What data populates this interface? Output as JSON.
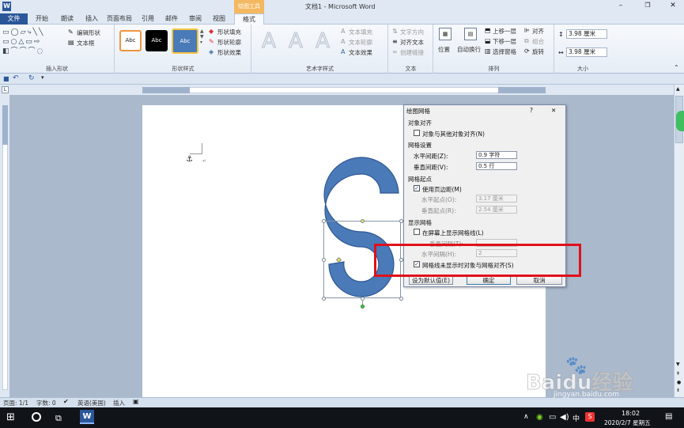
{
  "window": {
    "title": "文档1 - Microsoft Word",
    "context_tab_group": "绘图工具",
    "app_icon": "word-icon"
  },
  "tabs": [
    {
      "label": "文件"
    },
    {
      "label": "开始"
    },
    {
      "label": "朗读"
    },
    {
      "label": "插入"
    },
    {
      "label": "页面布局"
    },
    {
      "label": "引用"
    },
    {
      "label": "邮件"
    },
    {
      "label": "审阅"
    },
    {
      "label": "视图"
    },
    {
      "label": "格式"
    }
  ],
  "ribbon": {
    "insert_shapes": {
      "label": "插入形状",
      "edit_shape": "编辑形状",
      "text_box": "文本框"
    },
    "shape_styles": {
      "label": "形状样式",
      "sample": "Abc",
      "fill": "形状填充",
      "outline": "形状轮廓",
      "effects": "形状效果"
    },
    "wordart": {
      "label": "艺术字样式",
      "sample": "A",
      "text_fill": "文本填充",
      "text_outline": "文本轮廓",
      "text_effects": "文本效果"
    },
    "text": {
      "label": "文本",
      "direction": "文字方向",
      "align": "对齐文本",
      "link": "创建链接"
    },
    "arrange": {
      "label": "排列",
      "position": "位置",
      "wrap": "自动换行",
      "bring_forward": "上移一层",
      "send_backward": "下移一层",
      "selection_pane": "选择窗格",
      "align": "对齐",
      "group": "组合",
      "rotate": "旋转"
    },
    "size": {
      "label": "大小",
      "height": "3.98 厘米",
      "width": "3.98 厘米"
    }
  },
  "dialog": {
    "title": "绘图网格",
    "help": "?",
    "close": "✕",
    "section_align": "对象对齐",
    "snap_objects": {
      "label": "对象与其他对象对齐(N)",
      "checked": false
    },
    "section_grid": "网格设置",
    "h_spacing": {
      "label": "水平间距(Z):",
      "value": "0.9 字符"
    },
    "v_spacing": {
      "label": "垂直间距(V):",
      "value": "0.5 行"
    },
    "section_origin": "网格起点",
    "use_margins": {
      "label": "使用页边距(M)",
      "checked": true
    },
    "h_origin": {
      "label": "水平起点(O):",
      "value": "3.17 厘米"
    },
    "v_origin": {
      "label": "垂直起点(R):",
      "value": "2.54 厘米"
    },
    "section_show": "显示网格",
    "show_gridlines": {
      "label": "在屏幕上显示网格线(L)",
      "checked": false
    },
    "v_every": {
      "label": "垂直间隔(T):",
      "value": ""
    },
    "h_every": {
      "label": "水平间隔(H):",
      "value": "2"
    },
    "snap_when_hidden": {
      "label": "网格线未显示时对象与网格对齐(S)",
      "checked": true
    },
    "btn_default": "设为默认值(E)",
    "btn_ok": "确定",
    "btn_cancel": "取消"
  },
  "highlight_color": "#e0101a",
  "shape_color": "#4a7ab8",
  "status": {
    "page": "页面: 1/1",
    "words": "字数: 0",
    "language": "英语(美国)",
    "mode": "插入"
  },
  "taskbar": {
    "time": "18:02",
    "date": "2020/2/7 星期五",
    "ime": "中"
  },
  "watermark": {
    "text": "Baidu经验",
    "url": "jingyan.baidu.com"
  }
}
